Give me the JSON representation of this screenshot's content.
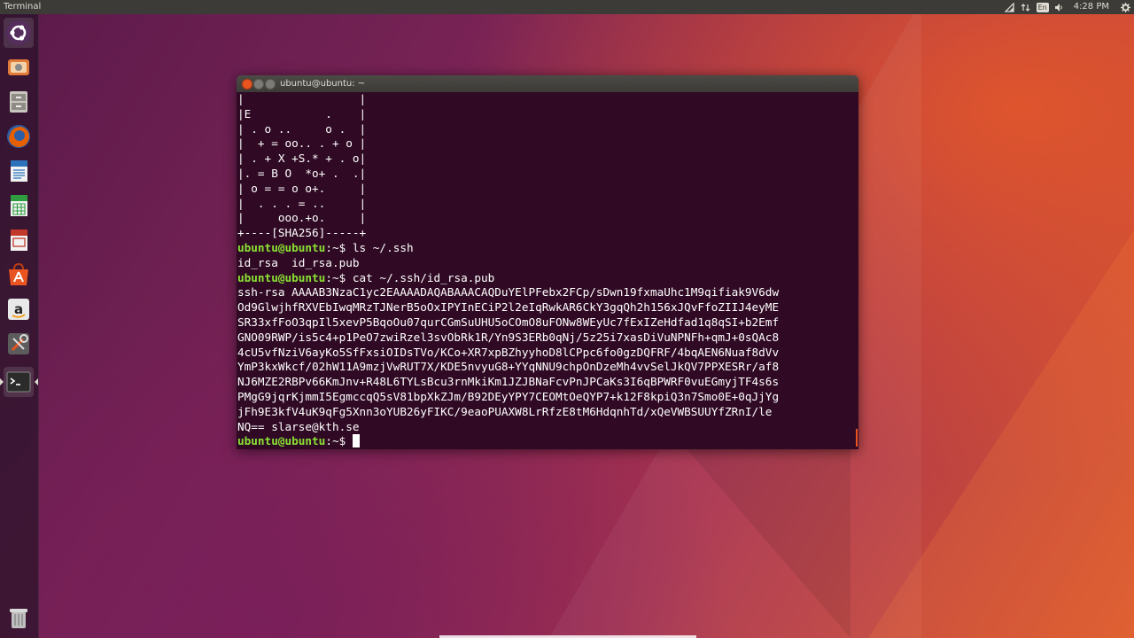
{
  "top_panel": {
    "app_title": "Terminal",
    "keyboard_layout": "En",
    "clock": "4:28 PM",
    "indicators": [
      "network-icon",
      "keyboard-icon",
      "volume-icon",
      "session-gear-icon"
    ]
  },
  "launcher": {
    "items": [
      {
        "name": "ubuntu-dash",
        "icon": "ubuntu-logo-icon"
      },
      {
        "name": "system-settings-app",
        "icon": "settings-app-icon"
      },
      {
        "name": "files",
        "icon": "file-cabinet-icon"
      },
      {
        "name": "firefox",
        "icon": "firefox-icon"
      },
      {
        "name": "libreoffice-writer",
        "icon": "writer-icon"
      },
      {
        "name": "libreoffice-calc",
        "icon": "calc-icon"
      },
      {
        "name": "libreoffice-impress",
        "icon": "impress-icon"
      },
      {
        "name": "ubuntu-software",
        "icon": "software-center-icon"
      },
      {
        "name": "amazon",
        "icon": "amazon-icon"
      },
      {
        "name": "system-tools",
        "icon": "wrench-screwdriver-icon"
      },
      {
        "name": "terminal",
        "icon": "terminal-icon"
      },
      {
        "name": "trash",
        "icon": "trash-icon"
      }
    ],
    "colors": {
      "accent": "#e95420"
    }
  },
  "window": {
    "title": "ubuntu@ubuntu: ~"
  },
  "terminal": {
    "colors": {
      "background": "#300a24",
      "text": "#ffffff",
      "prompt": "#8ae234"
    },
    "art": [
      "|                 |",
      "|E           .    |",
      "| . o ..     o .  |",
      "|  + = oo.. . + o |",
      "| . + X +S.* + . o|",
      "|. = B O  *o+ .  .|",
      "| o = = o o+.     |",
      "|  . . . = ..     |",
      "|     ooo.+o.     |",
      "+----[SHA256]-----+"
    ],
    "prompt": "ubuntu@ubuntu",
    "prompt_suffix": ":~$ ",
    "cmd1": "ls ~/.ssh",
    "out1": "id_rsa  id_rsa.pub",
    "cmd2": "cat ~/.ssh/id_rsa.pub",
    "key_lines": [
      "ssh-rsa AAAAB3NzaC1yc2EAAAADAQABAAACAQDuYElPFebx2FCp/sDwn19fxmaUhc1M9qifiak9V6dw",
      "Od9GlwjhfRXVEbIwqMRzTJNerB5oOxIPYInECiP2l2eIqRwkAR6CkY3gqQh2h156xJQvFfoZIIJ4eyME",
      "SR33xfFoO3qpIl5xevP5BqoOu07qurCGmSuUHU5oCOmO8uFONw8WEyUc7fExIZeHdfad1q8qSI+b2Emf",
      "GNO09RWP/is5c4+p1PeO7zwiRzel3svObRk1R/Yn9S3ERb0qNj/5z25i7xasDiVuNPNFh+qmJ+0sQAc8",
      "4cU5vfNziV6ayKo5SfFxsiOIDsTVo/KCo+XR7xpBZhyyhoD8lCPpc6fo0gzDQFRF/4bqAEN6Nuaf8dVv",
      "YmP3kxWkcf/02hW11A9mzjVwRUT7X/KDE5nvyuG8+YYqNNU9chpOnDzeMh4vvSelJkQV7PPXESRr/af8",
      "NJ6MZE2RBPv66KmJnv+R48L6TYLsBcu3rnMkiKm1JZJBNaFcvPnJPCaKs3I6qBPWRF0vuEGmyjTF4s6s",
      "PMgG9jqrKjmmI5EgmccqQ5sV81bpXkZJm/B92DEyYPY7CEOMtOeQYP7+k12F8kpiQ3n7Smo0E+0qJjYg",
      "jFh9E3kfV4uK9qFg5Xnn3oYUB26yFIKC/9eaoPUAXW8LrRfzE8tM6HdqnhTd/xQeVWBSUUYfZRnI/le",
      "NQ== slarse@kth.se"
    ]
  }
}
